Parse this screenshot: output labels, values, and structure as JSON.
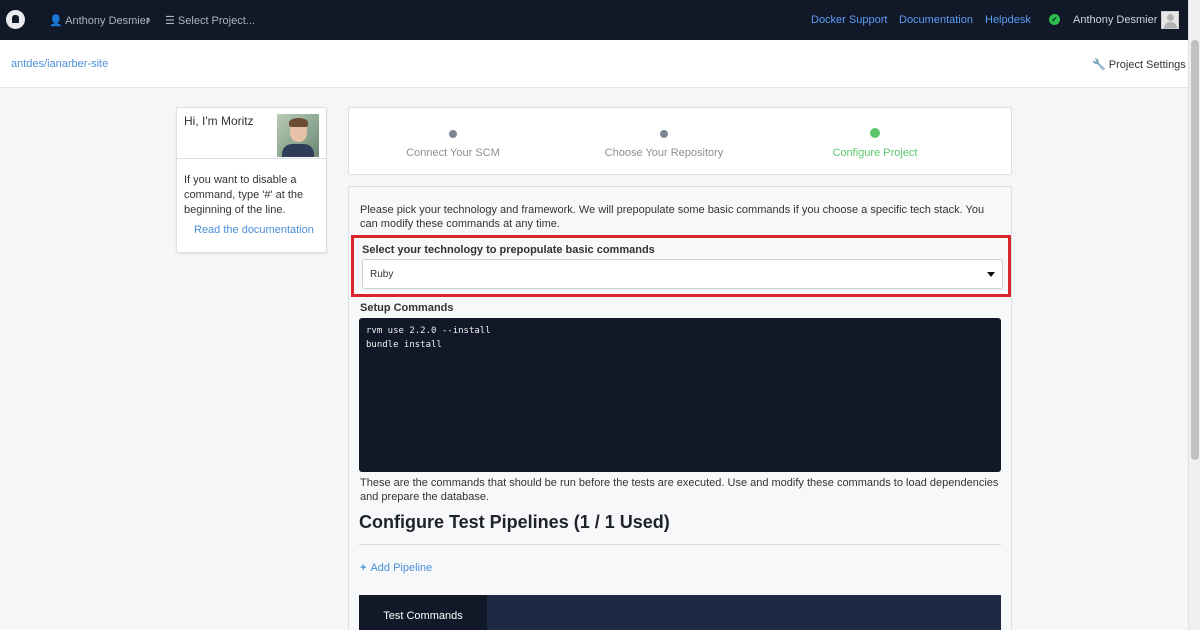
{
  "topbar": {
    "user_label": "Anthony Desmier",
    "project_label": "Select Project...",
    "links": [
      "Docker Support",
      "Documentation",
      "Helpdesk"
    ],
    "account_name": "Anthony Desmier"
  },
  "subbar": {
    "breadcrumb": "antdes/ianarber-site",
    "project_settings": "Project Settings"
  },
  "sidebar": {
    "greeting": "Hi, I'm Moritz",
    "hint": "If you want to disable a command, type '#' at the beginning of the line.",
    "docs_link": "Read the documentation"
  },
  "steps": [
    {
      "label": "Connect Your SCM",
      "state": "done"
    },
    {
      "label": "Choose Your Repository",
      "state": "done"
    },
    {
      "label": "Configure Project",
      "state": "active"
    }
  ],
  "main": {
    "intro": "Please pick your technology and framework. We will prepopulate some basic commands if you choose a specific tech stack. You can modify these commands at any time.",
    "tech_label": "Select your technology to prepopulate basic commands",
    "tech_value": "Ruby",
    "setup_label": "Setup Commands",
    "setup_lines": [
      "rvm use 2.2.0 --install",
      "bundle install"
    ],
    "setup_help": "These are the commands that should be run before the tests are executed. Use and modify these commands to load dependencies and prepare the database.",
    "pipelines_title": "Configure Test Pipelines (1 / 1 Used)",
    "add_pipeline": "Add Pipeline",
    "tab_label": "Test Commands"
  },
  "colors": {
    "topbar_bg": "#111827",
    "link_blue": "#4a8fd8",
    "active_green": "#5cc76a",
    "highlight_red": "#d9262c"
  }
}
